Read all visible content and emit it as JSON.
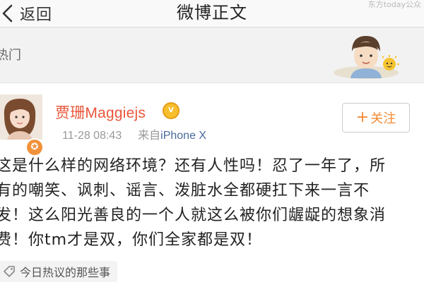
{
  "nav": {
    "back_label": "返回",
    "title": "微博正文",
    "watermark": "东方today公众"
  },
  "hot": {
    "label": "热门"
  },
  "post": {
    "user_name": "贾珊Maggiejs",
    "time": "11-28 08:43",
    "source_prefix": "来自",
    "source_device": "iPhone X",
    "follow_label": "关注",
    "text_lines": [
      "这是什么样的网络环境？还有人性吗！忍了一年了，所",
      "有的嘲笑、讽刺、谣言、泼脏水全都硬扛下来一言不",
      "发！这么阳光善良的一个人就这么被你们龌龊的想象消",
      "费！你tm才是双，你们全家都是双！"
    ],
    "tag_label": "今日热议的那些事"
  },
  "colors": {
    "accent_orange": "#f38b34",
    "username_red": "#e8563a",
    "source_blue": "#4a6a9d"
  },
  "icons": [
    "back-chevron-icon",
    "hot-illustration-icon",
    "verified-badge-icon",
    "vip-badge-icon",
    "plus-icon",
    "tag-icon"
  ]
}
